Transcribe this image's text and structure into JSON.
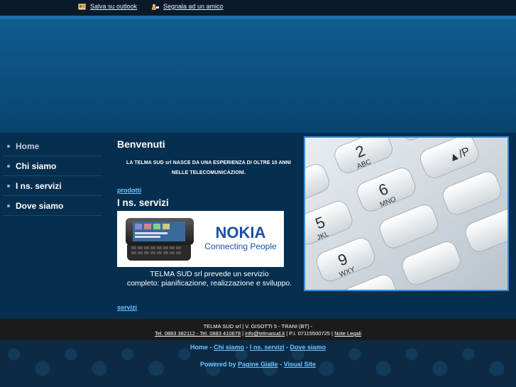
{
  "top_links": {
    "save_outlook": "Salva su outlook",
    "tell_friend": "Segnala ad un amico"
  },
  "menu": {
    "items": [
      "Home",
      "Chi siamo",
      "I ns. servizi",
      "Dove siamo"
    ]
  },
  "main": {
    "welcome_title": "Benvenuti",
    "intro_line1": "LA TELMA SUD srl NASCE DA UNA ESPERIENZA DI OLTRE 10 ANNI",
    "intro_line2": "NELLE TELECOMUNICAZIONI.",
    "products_link": "prodotti",
    "services_title": "I ns. servizi",
    "nokia_brand": "NOKIA",
    "nokia_tagline": "Connecting People",
    "desc_line1": "TELMA SUD srl prevede un servizio",
    "desc_line2": "completo: pianificazione, realizzazione e sviluppo.",
    "services_link": "servizi"
  },
  "footer": {
    "address": "TELMA SUD srl | V. GISOTTI 5 - TRANI (BT) -",
    "phones": "Tel. 0883 382112 - Tel. 0883 410678",
    "email": "info@telmasud.it",
    "vat": "| P.I. 07115500725 |",
    "legal": "Note Legali",
    "nav": [
      "Home",
      "Chi siamo",
      "I ns. servizi",
      "Dove siamo"
    ],
    "powered_label": "Powered by",
    "pagine_gialle": "Pagine Gialle",
    "visual_site": "Visual Site"
  },
  "colors": {
    "link": "#6ec3ff",
    "header_blue": "#0f5b8d",
    "content_bg": "#062f4f",
    "photo_border": "#3b8fd8"
  }
}
